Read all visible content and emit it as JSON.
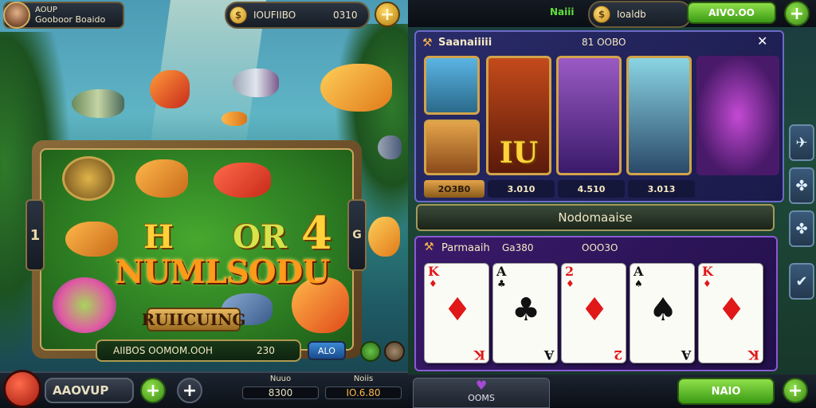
{
  "left_game": {
    "player_name_line1": "AOUP",
    "player_name_line2": "Gooboor Boaido",
    "coin_bar_label": "IOUFIIBO",
    "coin_bar_value": "0310",
    "coin_symbol": "$",
    "board": {
      "letter_h": "H",
      "letter_or": "OR",
      "letter_4": "4",
      "logo": "NUMLSODU",
      "action_button": "RUIICUING",
      "side_tab_left": "1",
      "side_tab_right": "G"
    },
    "status_bar": {
      "left_text": "AIIBOS OOMOM.OOH",
      "value": "230",
      "tag": "ALO"
    },
    "bottom": {
      "play_label": "AAOVUP",
      "plus": "+",
      "cross": "+",
      "stat1_label": "Nuuo",
      "stat1_value": "8300",
      "stat2_label": "Noiis",
      "stat2_value": "IO.6.80"
    }
  },
  "right_game": {
    "top": {
      "mode_label": "Naiii",
      "coin_label": "Ioaldb",
      "balance_button": "AIVO.OO",
      "plus": "+"
    },
    "heroes_panel": {
      "title": "Saanaiiiii",
      "value": "81 OOBO",
      "close": "✕",
      "hero_prices": [
        "2O3B0",
        "3.010",
        "4.510",
        "3.013"
      ],
      "hero_letters": "IU",
      "banner": "Nodomaaise"
    },
    "cards_panel": {
      "title": "Parmaaih",
      "value": "Ga380",
      "value2": "OOO3O",
      "cards": [
        {
          "rank": "K",
          "suit": "♦",
          "color": "red"
        },
        {
          "rank": "A",
          "suit": "♣",
          "color": "black"
        },
        {
          "rank": "2",
          "suit": "♦",
          "color": "red"
        },
        {
          "rank": "A",
          "suit": "♠",
          "color": "black"
        },
        {
          "rank": "K",
          "suit": "♦",
          "color": "red"
        }
      ]
    },
    "bottom": {
      "tab_label": "OOMS",
      "action_button": "NAIO",
      "plus": "+"
    },
    "side_icons": [
      "✈",
      "✤",
      "✤",
      "✔"
    ]
  },
  "colors": {
    "accent_green": "#5fbf2a",
    "gold": "#d4a44a",
    "purple_panel": "#2c2a6a"
  }
}
